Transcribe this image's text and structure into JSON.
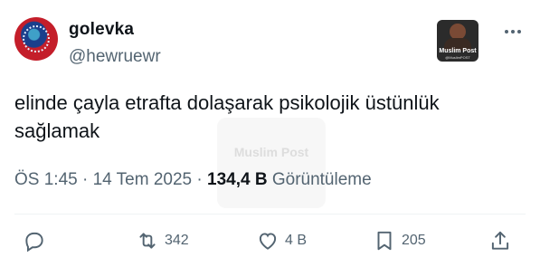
{
  "author": {
    "display_name": "golevka",
    "handle": "@hewruewr"
  },
  "media_thumbnail": {
    "title": "Muslim Post",
    "subtitle": "@MuslimPOST"
  },
  "watermark": {
    "text": "Muslim Post"
  },
  "tweet": {
    "text": "elinde çayla etrafta dolaşarak psikolojik üstünlük sağlamak"
  },
  "meta": {
    "time": "ÖS 1:45",
    "separator1": " · ",
    "date": "14 Tem 2025",
    "separator2": " · ",
    "views": "134,4 B",
    "views_label": "Görüntüleme"
  },
  "actions": {
    "reply_icon": "reply-icon",
    "retweet_icon": "retweet-icon",
    "retweet_count": "342",
    "like_icon": "heart-icon",
    "like_count": "4 B",
    "bookmark_icon": "bookmark-icon",
    "bookmark_count": "205",
    "share_icon": "share-icon"
  },
  "colors": {
    "text_primary": "#0f1419",
    "text_secondary": "#536471",
    "divider": "#eff3f4"
  }
}
